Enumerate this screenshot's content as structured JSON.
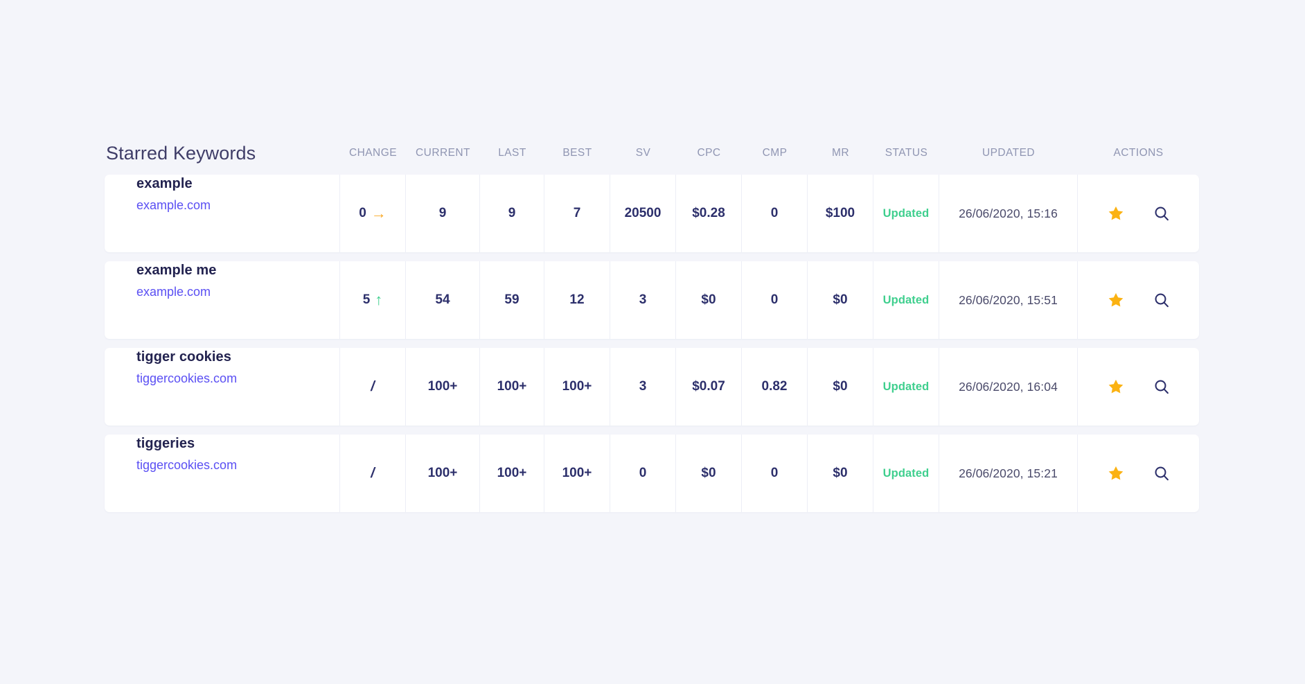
{
  "panel": {
    "title": "Starred Keywords"
  },
  "columns": [
    {
      "key": "change",
      "label": "CHANGE"
    },
    {
      "key": "current",
      "label": "CURRENT"
    },
    {
      "key": "last",
      "label": "LAST"
    },
    {
      "key": "best",
      "label": "BEST"
    },
    {
      "key": "sv",
      "label": "SV"
    },
    {
      "key": "cpc",
      "label": "CPC"
    },
    {
      "key": "cmp",
      "label": "CMP"
    },
    {
      "key": "mr",
      "label": "MR"
    },
    {
      "key": "status",
      "label": "STATUS"
    },
    {
      "key": "updated",
      "label": "UPDATED"
    },
    {
      "key": "actions",
      "label": "ACTIONS"
    }
  ],
  "colors": {
    "page_background": "#f4f5fa",
    "row_background": "#ffffff",
    "title": "#3f3d68",
    "header_text": "#8f95b2",
    "value_text": "#2c2f6b",
    "keyword_text": "#22224f",
    "domain_link": "#5a4ff3",
    "status_updated": "#3fcf8e",
    "change_flat_arrow": "#f9a825",
    "change_up_arrow": "#3fcf8e",
    "star_icon": "#fbb212",
    "search_icon": "#2c2f6b",
    "cell_divider": "#eceef6"
  },
  "rows": [
    {
      "keyword": "example",
      "domain": "example.com",
      "change": {
        "value": "0",
        "direction": "flat",
        "arrow": "→"
      },
      "current": "9",
      "last": "9",
      "best": "7",
      "sv": "20500",
      "cpc": "$0.28",
      "cmp": "0",
      "mr": "$100",
      "status": "Updated",
      "updated": "26/06/2020, 15:16",
      "starred": true
    },
    {
      "keyword": "example me",
      "domain": "example.com",
      "change": {
        "value": "5",
        "direction": "up",
        "arrow": "↑"
      },
      "current": "54",
      "last": "59",
      "best": "12",
      "sv": "3",
      "cpc": "$0",
      "cmp": "0",
      "mr": "$0",
      "status": "Updated",
      "updated": "26/06/2020, 15:51",
      "starred": true
    },
    {
      "keyword": "tigger cookies",
      "domain": "tiggercookies.com",
      "change": {
        "value": "/",
        "direction": "none",
        "arrow": ""
      },
      "current": "100+",
      "last": "100+",
      "best": "100+",
      "sv": "3",
      "cpc": "$0.07",
      "cmp": "0.82",
      "mr": "$0",
      "status": "Updated",
      "updated": "26/06/2020, 16:04",
      "starred": true
    },
    {
      "keyword": "tiggeries",
      "domain": "tiggercookies.com",
      "change": {
        "value": "/",
        "direction": "none",
        "arrow": ""
      },
      "current": "100+",
      "last": "100+",
      "best": "100+",
      "sv": "0",
      "cpc": "$0",
      "cmp": "0",
      "mr": "$0",
      "status": "Updated",
      "updated": "26/06/2020, 15:21",
      "starred": true
    }
  ],
  "icons": {
    "star": "star-icon",
    "search": "search-icon"
  }
}
